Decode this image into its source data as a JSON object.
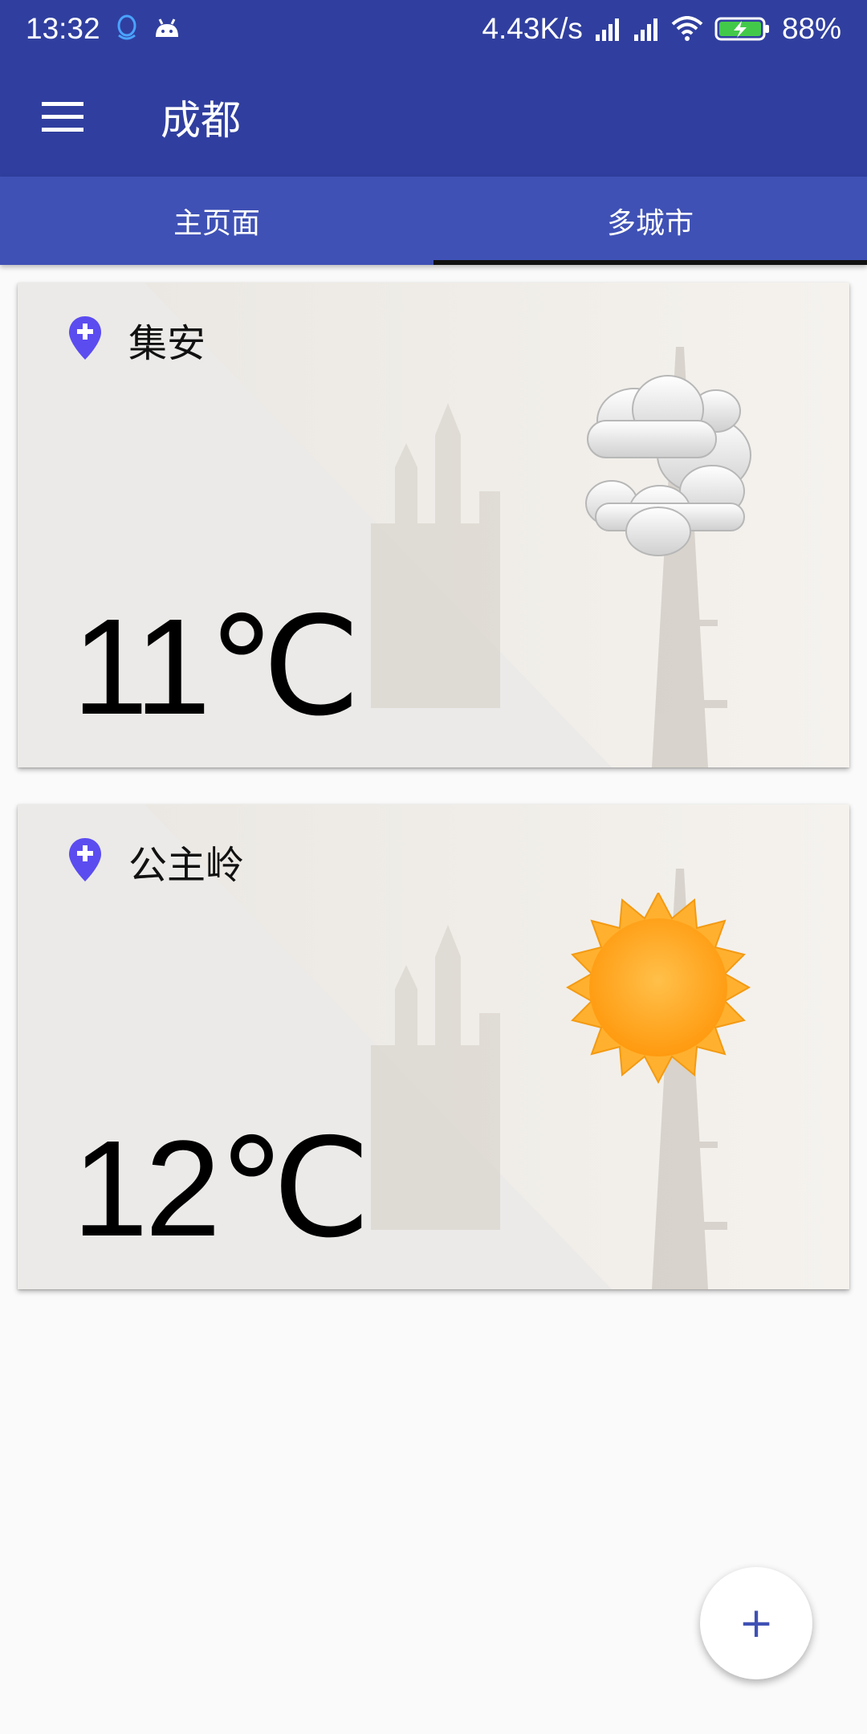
{
  "status_bar": {
    "time": "13:32",
    "left_icons": [
      "qq-icon",
      "android-icon"
    ],
    "net_speed": "4.43K/s",
    "battery": "88%",
    "right_icons": [
      "signal-icon",
      "signal-icon",
      "wifi-icon",
      "battery-charging-icon"
    ]
  },
  "app_bar": {
    "title": "成都",
    "menu_icon": "hamburger-menu-icon"
  },
  "tabs": [
    {
      "label": "主页面",
      "active": false
    },
    {
      "label": "多城市",
      "active": true
    }
  ],
  "cities": [
    {
      "name": "集安",
      "temperature": "11℃",
      "weather_icon": "cloudy-icon"
    },
    {
      "name": "公主岭",
      "temperature": "12℃",
      "weather_icon": "sunny-icon"
    }
  ],
  "fab": {
    "label": "+"
  },
  "colors": {
    "primary_dark": "#303f9f",
    "primary": "#3f51b5",
    "pin": "#5b4cf0"
  }
}
